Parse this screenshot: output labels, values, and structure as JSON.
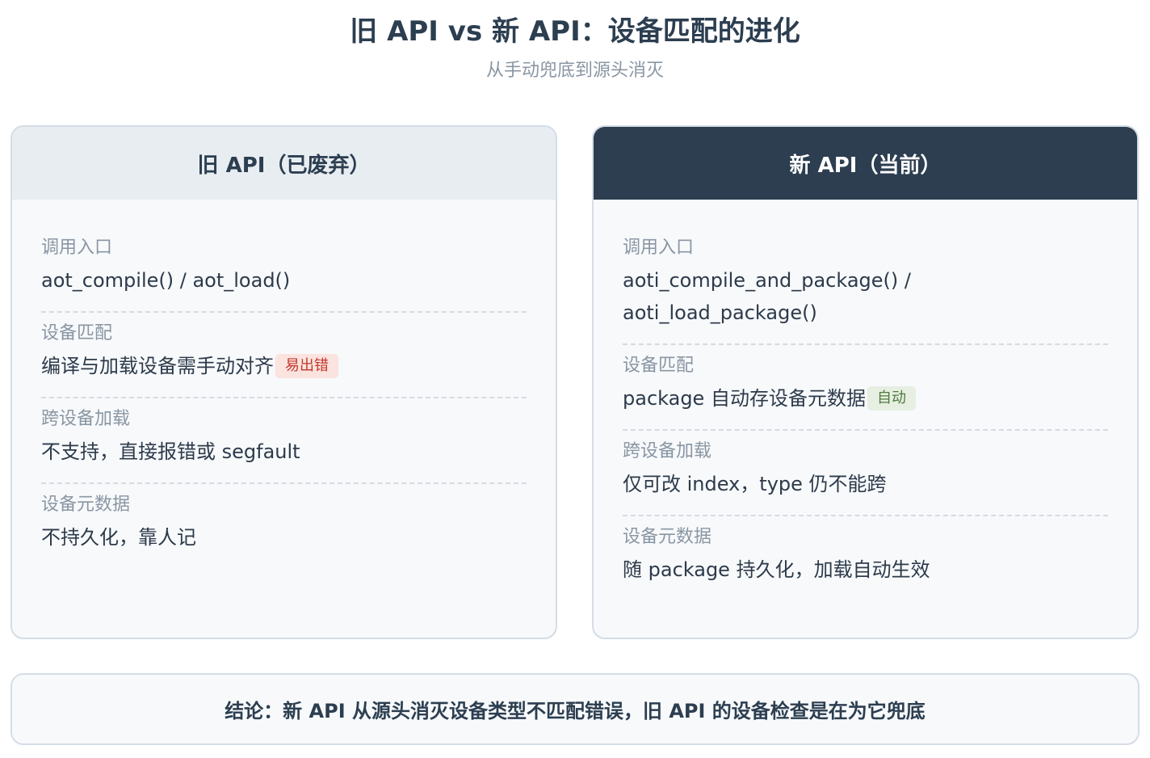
{
  "title": "旧 API vs 新 API：设备匹配的进化",
  "subtitle": "从手动兜底到源头消灭",
  "panels": [
    {
      "header": "旧 API（已废弃）",
      "rows": [
        {
          "label": "调用入口",
          "value": "aot_compile() / aot_load()",
          "tag": ""
        },
        {
          "label": "设备匹配",
          "value": "编译与加载设备需手动对齐",
          "tag": "易出错"
        },
        {
          "label": "跨设备加载",
          "value": "不支持，直接报错或 segfault",
          "tag": ""
        },
        {
          "label": "设备元数据",
          "value": "不持久化，靠人记",
          "tag": ""
        }
      ]
    },
    {
      "header": "新 API（当前）",
      "rows": [
        {
          "label": "调用入口",
          "value": "aoti_compile_and_package() / aoti_load_package()",
          "tag": ""
        },
        {
          "label": "设备匹配",
          "value": "package 自动存设备元数据",
          "tag": "自动"
        },
        {
          "label": "跨设备加载",
          "value": "仅可改 index，type 仍不能跨",
          "tag": ""
        },
        {
          "label": "设备元数据",
          "value": "随 package 持久化，加载自动生效",
          "tag": ""
        }
      ]
    }
  ],
  "conclusion": "结论：新 API 从源头消灭设备类型不匹配错误，旧 API 的设备检查是在为它兜底",
  "colors": {
    "header_dark": "#2c3e50",
    "header_light": "#e8edf1",
    "tag_warn_bg": "#fbe3df",
    "tag_warn_text": "#c0392b",
    "tag_ok_bg": "#e6efe2",
    "tag_ok_text": "#4f7a3a"
  }
}
